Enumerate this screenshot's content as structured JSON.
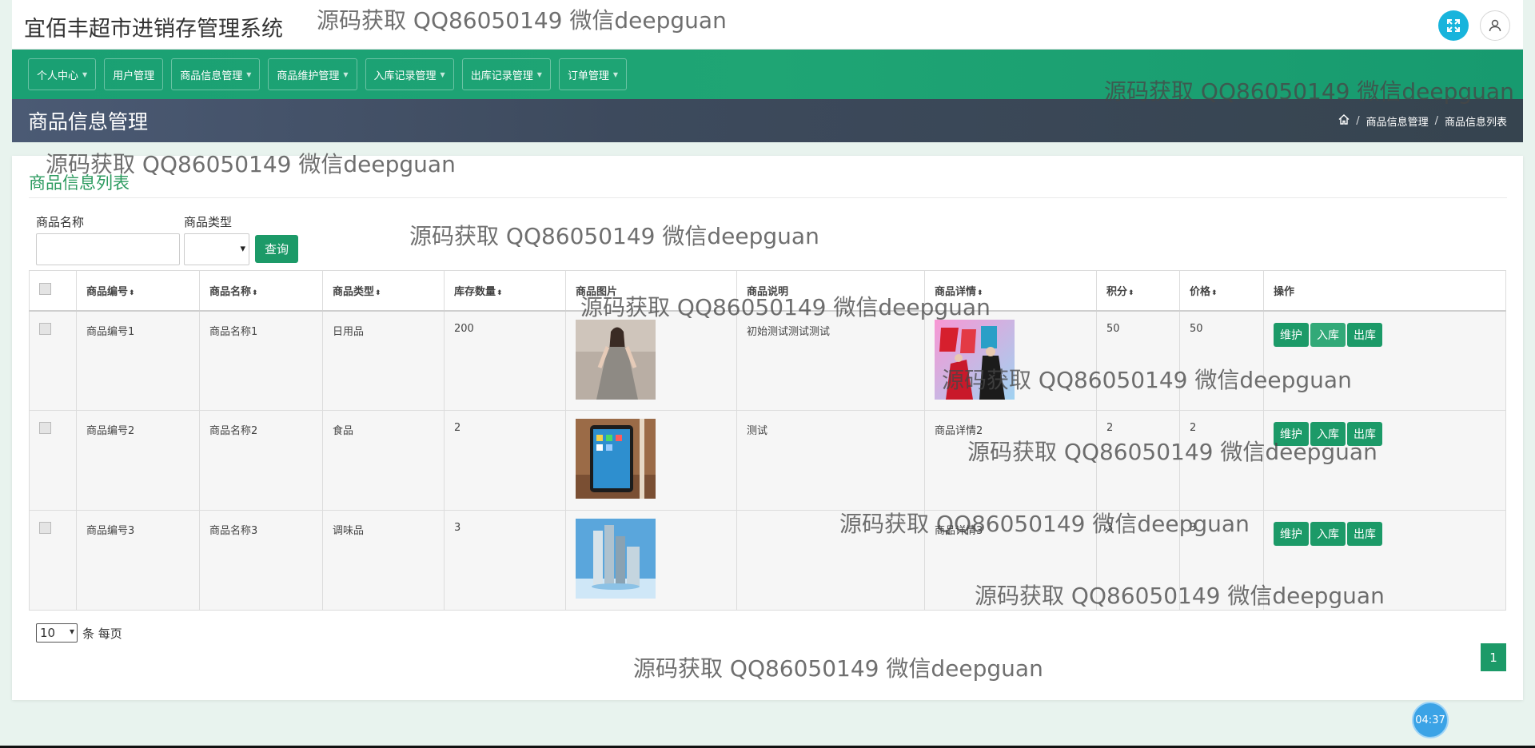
{
  "header": {
    "app_title": "宜佰丰超市进销存管理系统",
    "expand_icon": "expand-icon",
    "user_icon": "user-icon"
  },
  "nav": [
    {
      "label": "个人中心"
    },
    {
      "label": "用户管理"
    },
    {
      "label": "商品信息管理"
    },
    {
      "label": "商品维护管理"
    },
    {
      "label": "入库记录管理"
    },
    {
      "label": "出库记录管理"
    },
    {
      "label": "订单管理"
    }
  ],
  "page_bar": {
    "title": "商品信息管理",
    "breadcrumb": [
      "商品信息管理",
      "商品信息列表"
    ],
    "separator": "/"
  },
  "card": {
    "title": "商品信息列表"
  },
  "search": {
    "name_label": "商品名称",
    "name_value": "",
    "type_label": "商品类型",
    "type_value": "",
    "query_label": "查询"
  },
  "table": {
    "headers": [
      "商品编号",
      "商品名称",
      "商品类型",
      "库存数量",
      "商品图片",
      "商品说明",
      "商品详情",
      "积分",
      "价格",
      "操作"
    ],
    "sort_glyph": "⬍",
    "rows": [
      {
        "code": "商品编号1",
        "name": "商品名称1",
        "type": "日用品",
        "stock": "200",
        "desc": "初始测试测试测试",
        "detail": "",
        "points": "50",
        "price": "50"
      },
      {
        "code": "商品编号2",
        "name": "商品名称2",
        "type": "食品",
        "stock": "2",
        "desc": "测试",
        "detail": "商品详情2",
        "points": "2",
        "price": "2"
      },
      {
        "code": "商品编号3",
        "name": "商品名称3",
        "type": "调味品",
        "stock": "3",
        "desc": "",
        "detail": "商品详情3",
        "points": "3",
        "price": "3"
      }
    ],
    "op_labels": {
      "maintain": "维护",
      "stock_in": "入库",
      "stock_out": "出库"
    }
  },
  "pager": {
    "page_size": "10",
    "per_page_text": "条 每页",
    "current_page": "1"
  },
  "timer": "04:37",
  "watermark_text": "源码获取 QQ86050149 微信deepguan",
  "colors": {
    "accent_green": "#1c9a68",
    "nav_green": "#1fa574",
    "page_bar": "#3d4a5d",
    "title_green": "#2d9b60"
  }
}
